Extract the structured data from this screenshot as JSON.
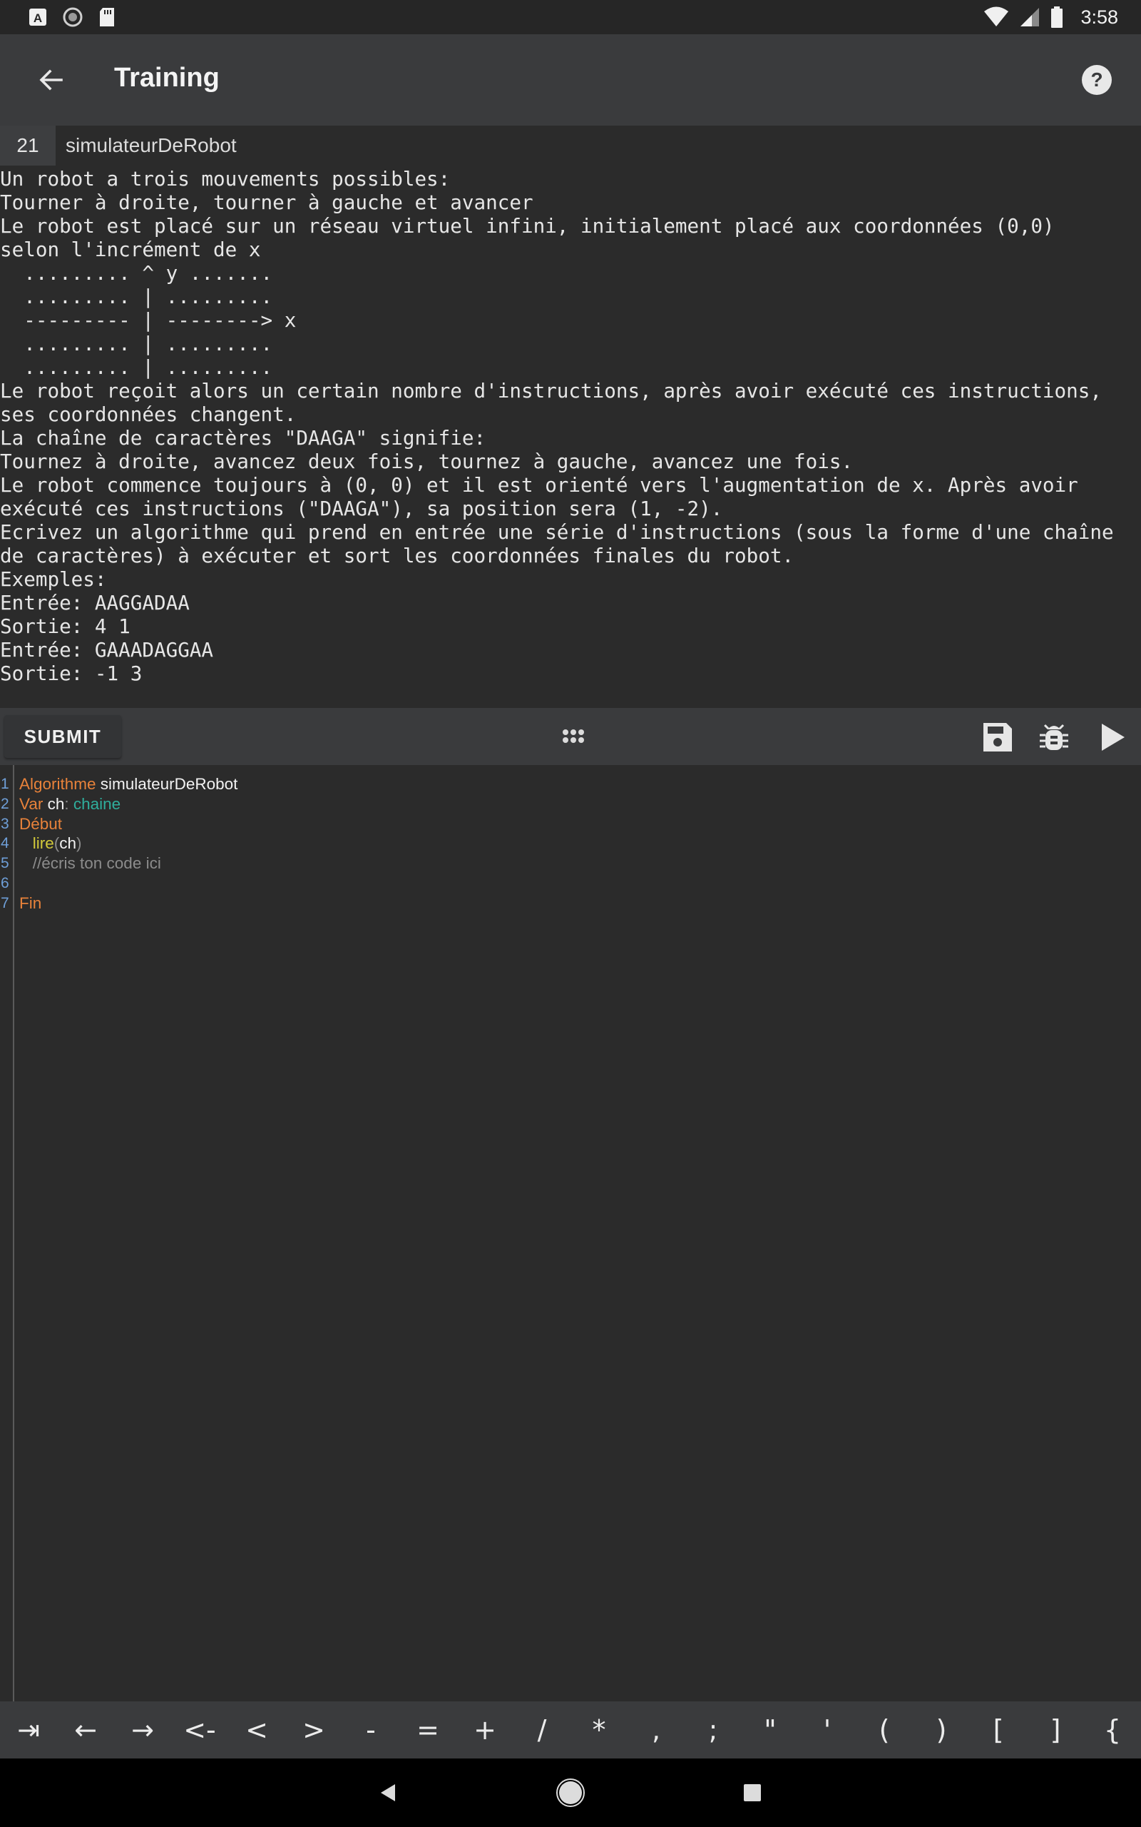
{
  "status_bar": {
    "time": "3:58",
    "icons": [
      "font-a-icon",
      "sync-circle-icon",
      "sd-card-icon",
      "wifi-icon",
      "signal-icon",
      "battery-icon"
    ]
  },
  "app_bar": {
    "title": "Training",
    "icons": [
      "arrow-back-icon",
      "help-circle-icon"
    ]
  },
  "problem": {
    "number": "21",
    "name": "simulateurDeRobot",
    "statement_lines": [
      "Un robot a trois mouvements possibles:",
      "Tourner à droite, tourner à gauche et avancer",
      "Le robot est placé sur un réseau virtuel infini, initialement placé aux coordonnées (0,0)",
      "selon l'incrément de x",
      "  ......... ^ y .......",
      "  ......... | .........",
      "  --------- | --------> x",
      "  ......... | .........",
      "  ......... | .........",
      "Le robot reçoit alors un certain nombre d'instructions, après avoir exécuté ces instructions,",
      "ses coordonnées changent.",
      "La chaîne de caractères \"DAAGA\" signifie:",
      "Tournez à droite, avancez deux fois, tournez à gauche, avancez une fois.",
      "Le robot commence toujours à (0, 0) et il est orienté vers l'augmentation de x. Après avoir",
      "exécuté ces instructions (\"DAAGA\"), sa position sera (1, -2).",
      "Ecrivez un algorithme qui prend en entrée une série d'instructions (sous la forme d'une chaîne",
      "de caractères) à exécuter et sort les coordonnées finales du robot.",
      "Exemples:",
      "Entrée: AAGGADAA",
      "Sortie: 4 1",
      "Entrée: GAAADAGGAA",
      "Sortie: -1 3"
    ]
  },
  "toolbar": {
    "submit_label": "SUBMIT",
    "icons": [
      "grid-dots-icon",
      "save-icon",
      "debug-bug-icon",
      "play-icon"
    ]
  },
  "editor": {
    "lines": [
      {
        "n": "1",
        "tokens": [
          {
            "t": "Algorithme",
            "c": "kw"
          },
          {
            "t": " simulateurDeRobot",
            "c": "id"
          }
        ]
      },
      {
        "n": "2",
        "tokens": [
          {
            "t": "Var",
            "c": "kw"
          },
          {
            "t": " ch",
            "c": "id"
          },
          {
            "t": ": ",
            "c": "cm"
          },
          {
            "t": "chaine",
            "c": "ty"
          }
        ]
      },
      {
        "n": "3",
        "tokens": [
          {
            "t": "Début",
            "c": "kw"
          }
        ]
      },
      {
        "n": "4",
        "tokens": [
          {
            "t": "   ",
            "c": "id"
          },
          {
            "t": "lire",
            "c": "fn"
          },
          {
            "t": "(",
            "c": "cm"
          },
          {
            "t": "ch",
            "c": "id"
          },
          {
            "t": ")",
            "c": "cm"
          }
        ]
      },
      {
        "n": "5",
        "tokens": [
          {
            "t": "   //écris ton code ici",
            "c": "cm"
          }
        ]
      },
      {
        "n": "6",
        "tokens": []
      },
      {
        "n": "7",
        "tokens": [
          {
            "t": "Fin",
            "c": "kw"
          }
        ]
      }
    ]
  },
  "symbol_bar": {
    "keys": [
      "⇥",
      "←",
      "→",
      "<-",
      "<",
      ">",
      "-",
      "=",
      "+",
      "/",
      "*",
      ",",
      ";",
      "\"",
      "'",
      "(",
      ")",
      "[",
      "]",
      "{"
    ]
  },
  "nav_bar": {
    "icons": [
      "nav-back-icon",
      "nav-home-icon",
      "nav-recents-icon"
    ]
  },
  "colors": {
    "background": "#2b2b2b",
    "app_bar": "#3a3b3d",
    "keyword": "#e8823a",
    "type": "#2fae9c",
    "function": "#d2c93a",
    "comment": "#8c8c8c",
    "line_number": "#6f9fd8"
  }
}
